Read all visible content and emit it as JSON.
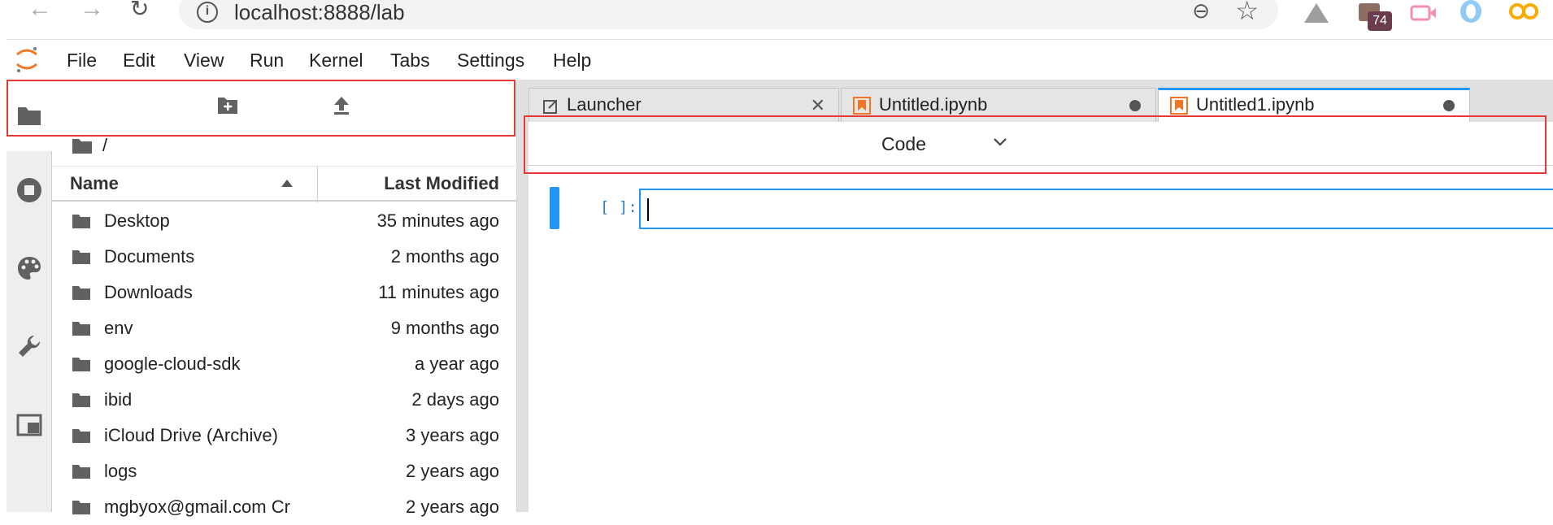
{
  "browser": {
    "back_icon": "arrow-left-icon",
    "forward_icon": "arrow-right-icon",
    "reload_icon": "reload-icon",
    "url": "localhost:8888/lab",
    "extension_badge": "74"
  },
  "menubar": {
    "items": [
      "File",
      "Edit",
      "View",
      "Run",
      "Kernel",
      "Tabs",
      "Settings",
      "Help"
    ]
  },
  "filebrowser": {
    "breadcrumb": "/",
    "columns": {
      "name": "Name",
      "modified": "Last Modified"
    },
    "files": [
      {
        "name": "Desktop",
        "modified": "35 minutes ago"
      },
      {
        "name": "Documents",
        "modified": "2 months ago"
      },
      {
        "name": "Downloads",
        "modified": "11 minutes ago"
      },
      {
        "name": "env",
        "modified": "9 months ago"
      },
      {
        "name": "google-cloud-sdk",
        "modified": "a year ago"
      },
      {
        "name": "ibid",
        "modified": "2 days ago"
      },
      {
        "name": "iCloud Drive (Archive)",
        "modified": "3 years ago"
      },
      {
        "name": "logs",
        "modified": "2 years ago"
      },
      {
        "name": "mgbyox@gmail.com Cr",
        "modified": "2 years ago"
      }
    ]
  },
  "tabs": [
    {
      "label": "Launcher",
      "kind": "launcher"
    },
    {
      "label": "Untitled.ipynb",
      "kind": "notebook"
    },
    {
      "label": "Untitled1.ipynb",
      "kind": "notebook",
      "active": true
    }
  ],
  "notebook": {
    "cell_type": "Code",
    "prompt": "[ ]:"
  },
  "colors": {
    "accent": "#2196f3",
    "annotation": "#e53935",
    "notebook_icon": "#f37626"
  }
}
